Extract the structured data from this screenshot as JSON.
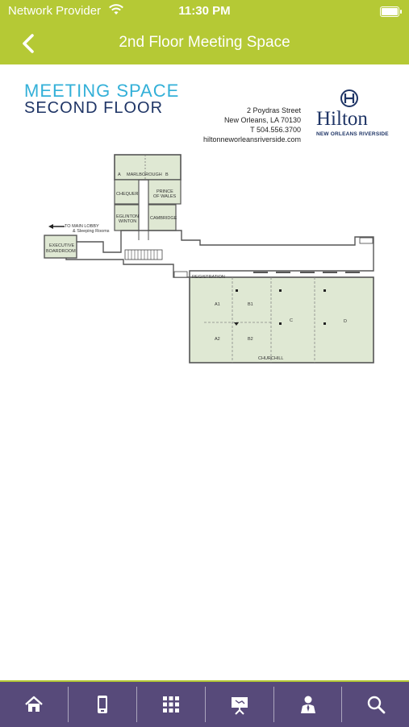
{
  "status_bar": {
    "carrier": "Network Provider",
    "time": "11:30 PM"
  },
  "nav": {
    "title": "2nd Floor Meeting Space",
    "back_icon": "chevron-left-icon"
  },
  "floorplan": {
    "heading_line1": "MEETING SPACE",
    "heading_line2": "SECOND FLOOR",
    "address": {
      "street": "2 Poydras Street",
      "city": "New Orleans, LA 70130",
      "phone": "T 504.556.3700",
      "website": "hiltonneworleansriverside.com"
    },
    "brand": {
      "name": "Hilton",
      "sub": "NEW ORLEANS RIVERSIDE"
    },
    "rooms": {
      "marlborough_a": "A",
      "marlborough": "MARLBOROUGH",
      "marlborough_b": "B",
      "chequer": "CHEQUER",
      "prince_1": "PRINCE",
      "prince_2": "OF WALES",
      "eglinton_1": "EGLINTON",
      "eglinton_2": "WINTON",
      "cambridge": "CAMBRIDGE",
      "executive_1": "EXECUTIVE",
      "executive_2": "BOARDROOM",
      "registration": "REGISTRATION",
      "a1": "A1",
      "a2": "A2",
      "b1": "B1",
      "b2": "B2",
      "c": "C",
      "d": "D",
      "churchill": "CHURCHILL"
    },
    "lobby_1": "TO MAIN LOBBY",
    "lobby_2": "& Sleeping Rooms"
  },
  "tabs": [
    {
      "icon": "home-icon"
    },
    {
      "icon": "mobile-device-icon"
    },
    {
      "icon": "grid-icon"
    },
    {
      "icon": "presentation-easel-icon"
    },
    {
      "icon": "speaker-person-icon"
    },
    {
      "icon": "search-icon"
    }
  ],
  "colors": {
    "accent_green": "#b5c935",
    "tab_purple": "#574a7a",
    "room_fill": "#dfe8d3",
    "heading_blue": "#33b0d8",
    "heading_navy": "#1f3566"
  }
}
